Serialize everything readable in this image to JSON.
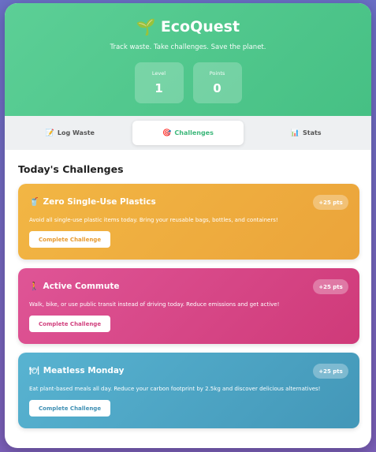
{
  "header": {
    "logo_icon": "🌱",
    "title": "EcoQuest",
    "tagline": "Track waste. Take challenges. Save the planet.",
    "stats": [
      {
        "label": "Level",
        "value": "1"
      },
      {
        "label": "Points",
        "value": "0"
      }
    ]
  },
  "tabs": [
    {
      "icon": "📝",
      "label": "Log Waste",
      "active": false
    },
    {
      "icon": "🎯",
      "label": "Challenges",
      "active": true
    },
    {
      "icon": "📊",
      "label": "Stats",
      "active": false
    }
  ],
  "section_title": "Today's Challenges",
  "challenges": [
    {
      "icon": "🥤",
      "title": "Zero Single-Use Plastics",
      "points": "+25 pts",
      "description": "Avoid all single-use plastic items today. Bring your reusable bags, bottles, and containers!",
      "button": "Complete Challenge",
      "color": "#eba43a"
    },
    {
      "icon": "🚶",
      "title": "Active Commute",
      "points": "+25 pts",
      "description": "Walk, bike, or use public transit instead of driving today. Reduce emissions and get active!",
      "button": "Complete Challenge",
      "color": "#cf3a79"
    },
    {
      "icon": "🍽",
      "title": "Meatless Monday",
      "points": "+25 pts",
      "description": "Eat plant-based meals all day. Reduce your carbon footprint by 2.5kg and discover delicious alternatives!",
      "button": "Complete Challenge",
      "color": "#4397b8"
    }
  ],
  "colors": {
    "accent": "#3cb77a",
    "header": "#5ccf96",
    "background": "#6b6fc6"
  }
}
